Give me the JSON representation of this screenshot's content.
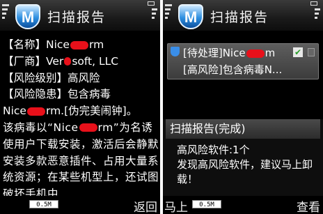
{
  "app": {
    "title": "扫描报告",
    "logo_letter": "M"
  },
  "left_screen": {
    "name_line": [
      "【名称】Nice",
      "rm"
    ],
    "vendor_line": [
      "【厂商】Ver",
      "soft, LLC"
    ],
    "risk_level_line": "【风险级别】高风险",
    "risk_line": "【风险隐患】包含病毒",
    "virus_line": [
      "Nice",
      "rm.[伪完美闹钟]。"
    ],
    "description": [
      "该病毒以“Nice",
      "rm”为名诱使用户下载安装，激活后会静默安装多款恶意插件、占用大量系统资源；在某些机型上，还试图破坏手机中"
    ],
    "memory": "0.5M",
    "right_softkey": "返回"
  },
  "right_screen": {
    "list_item": {
      "line1": [
        "[待处理]Nice",
        "m"
      ],
      "line2": "[高风险]包含病毒N..."
    },
    "dialog": {
      "title": "扫描报告(完成)",
      "line1": "高风险软件:1个",
      "line2": "发现高风险软件，建议马上卸载！"
    },
    "memory": "0.5M",
    "left_softkey": "马上",
    "right_softkey": "查看"
  },
  "colors": {
    "redaction": "#e8101a",
    "accent_blue": "#2d8fe0"
  }
}
